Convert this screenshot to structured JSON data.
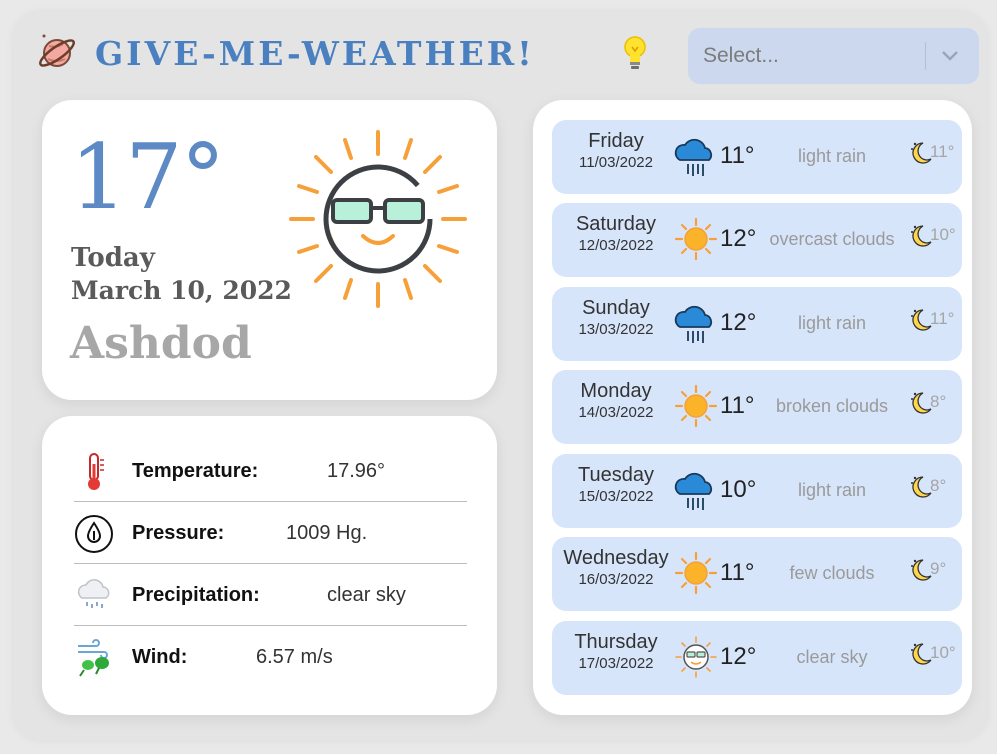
{
  "app": {
    "title": "GIVE-ME-WEATHER!",
    "logo_icon": "planet-icon",
    "theme_icon": "lightbulb-icon"
  },
  "search": {
    "placeholder": "Select...",
    "dropdown_icon": "chevron-down-icon"
  },
  "current": {
    "temperature": "17°",
    "today_label": "Today",
    "date": "March 10, 2022",
    "city": "Ashdod",
    "icon": "sun-with-sunglasses-icon"
  },
  "details": [
    {
      "label": "Temperature:",
      "value": "17.96°",
      "icon": "thermometer-icon"
    },
    {
      "label": "Pressure:",
      "value": "1009 Hg.",
      "icon": "pressure-drop-icon"
    },
    {
      "label": "Precipitation:",
      "value": "clear sky",
      "icon": "rain-cloud-icon"
    },
    {
      "label": "Wind:",
      "value": "6.57 m/s",
      "icon": "wind-icon"
    }
  ],
  "forecast": [
    {
      "day": "Friday",
      "date": "11/03/2022",
      "icon": "rain-cloud-icon",
      "max": "11°",
      "desc": "light rain",
      "min": "11°"
    },
    {
      "day": "Saturday",
      "date": "12/03/2022",
      "icon": "sun-icon",
      "max": "12°",
      "desc": "overcast clouds",
      "min": "10°"
    },
    {
      "day": "Sunday",
      "date": "13/03/2022",
      "icon": "rain-cloud-icon",
      "max": "12°",
      "desc": "light rain",
      "min": "11°"
    },
    {
      "day": "Monday",
      "date": "14/03/2022",
      "icon": "sun-icon",
      "max": "11°",
      "desc": "broken clouds",
      "min": "8°"
    },
    {
      "day": "Tuesday",
      "date": "15/03/2022",
      "icon": "rain-cloud-icon",
      "max": "10°",
      "desc": "light rain",
      "min": "8°"
    },
    {
      "day": "Wednesday",
      "date": "16/03/2022",
      "icon": "sun-icon",
      "max": "11°",
      "desc": "few clouds",
      "min": "9°"
    },
    {
      "day": "Thursday",
      "date": "17/03/2022",
      "icon": "sun-with-sunglasses-icon",
      "max": "12°",
      "desc": "clear sky",
      "min": "10°"
    }
  ],
  "colors": {
    "title": "#4a7fc0",
    "forecast_row_bg": "#d7e5fb",
    "select_bg": "#cbd8ee",
    "sun_orange": "#f6a03a"
  }
}
